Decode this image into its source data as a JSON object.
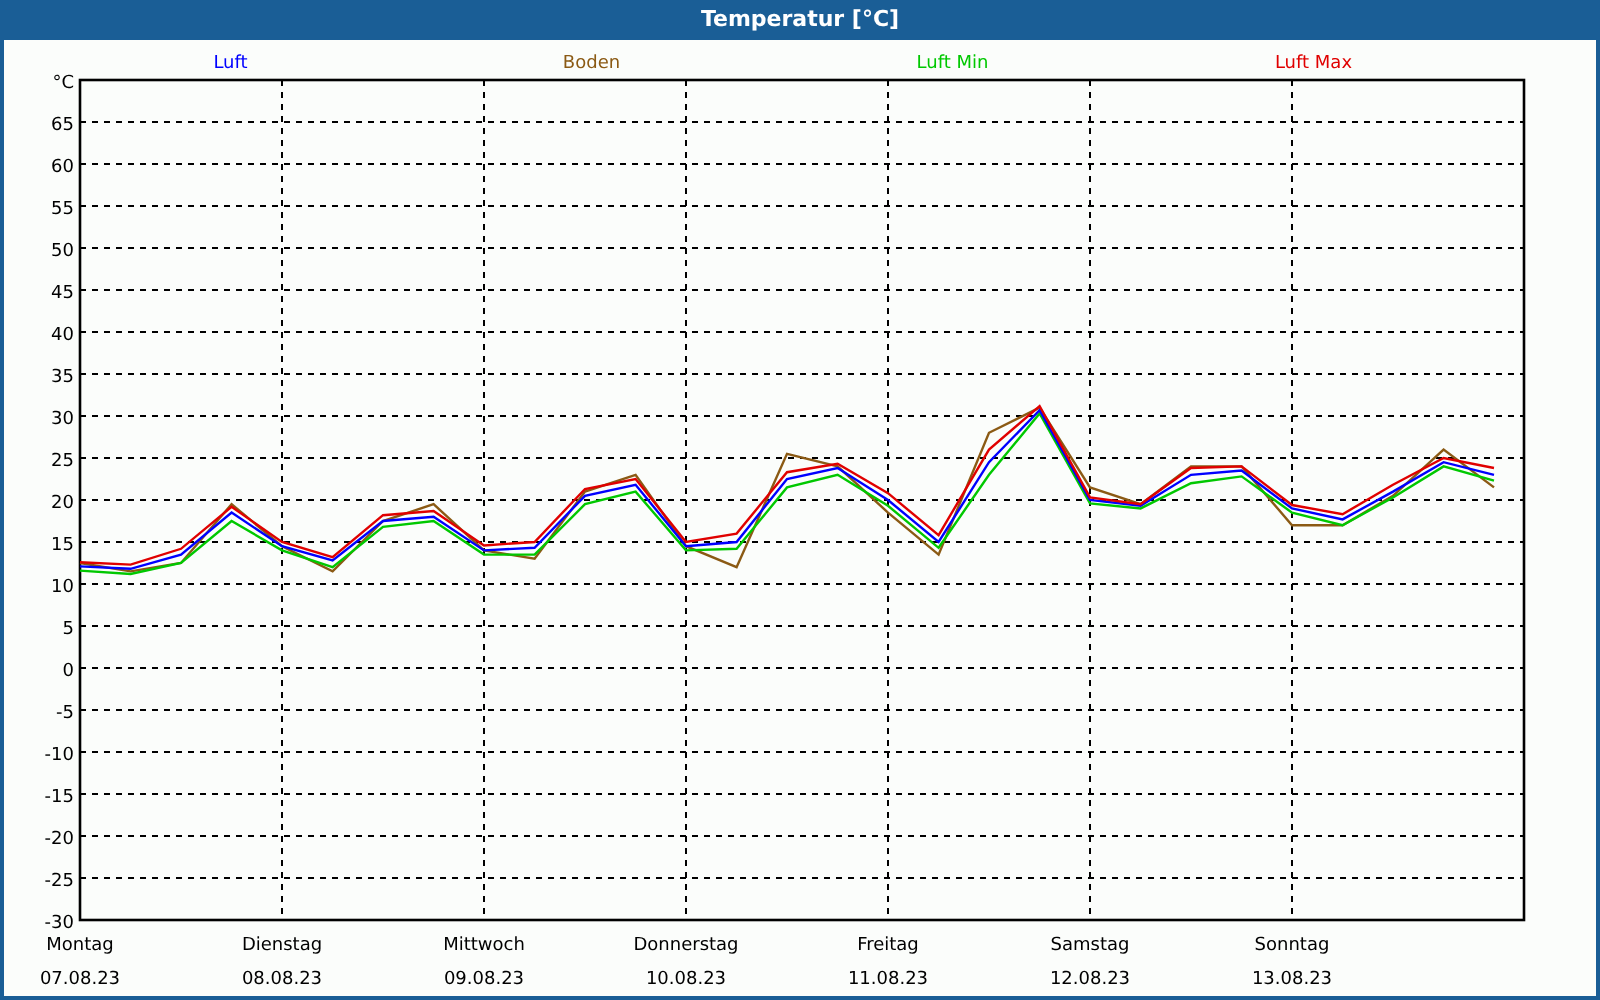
{
  "chart_data": {
    "type": "line",
    "title": "Temperatur [°C]",
    "categories": [
      "Montag 07.08.23",
      null,
      null,
      null,
      "Dienstag 08.08.23",
      null,
      null,
      null,
      "Mittwoch 09.08.23",
      null,
      null,
      null,
      "Donnerstag 10.08.23",
      null,
      null,
      null,
      "Freitag 11.08.23",
      null,
      null,
      null,
      "Samstag 12.08.23",
      null,
      null,
      null,
      "Sonntag 13.08.23",
      null,
      null,
      null,
      null
    ],
    "series": [
      {
        "name": "Luft",
        "color": "#0000ff",
        "values": [
          12.1,
          11.8,
          13.5,
          18.5,
          14.5,
          12.8,
          17.5,
          18.0,
          14.0,
          14.3,
          20.5,
          21.8,
          14.5,
          15.0,
          22.5,
          23.8,
          20.0,
          15.0,
          24.5,
          30.7,
          20.0,
          19.3,
          23.0,
          23.5,
          19.0,
          17.7,
          21.0,
          24.5,
          23.0
        ]
      },
      {
        "name": "Boden",
        "color": "#8b5a14",
        "values": [
          12.5,
          11.5,
          12.5,
          19.5,
          14.5,
          11.5,
          17.5,
          19.5,
          14.0,
          13.0,
          21.0,
          23.0,
          14.5,
          12.0,
          25.5,
          24.0,
          18.5,
          13.5,
          28.0,
          31.0,
          21.5,
          19.5,
          24.0,
          24.0,
          17.0,
          17.0,
          20.5,
          26.0,
          21.5
        ]
      },
      {
        "name": "Luft Min",
        "color": "#00c800",
        "values": [
          11.6,
          11.2,
          12.5,
          17.5,
          14.0,
          12.0,
          16.8,
          17.5,
          13.5,
          13.5,
          19.5,
          21.0,
          14.0,
          14.2,
          21.5,
          23.0,
          19.3,
          14.3,
          23.0,
          30.3,
          19.6,
          19.0,
          22.0,
          22.8,
          18.5,
          17.0,
          20.3,
          24.0,
          22.3
        ]
      },
      {
        "name": "Luft Max",
        "color": "#e00000",
        "values": [
          12.6,
          12.3,
          14.2,
          19.2,
          15.0,
          13.2,
          18.2,
          18.7,
          14.6,
          15.0,
          21.3,
          22.5,
          15.0,
          16.0,
          23.3,
          24.3,
          20.8,
          15.8,
          26.0,
          31.2,
          20.3,
          19.5,
          23.8,
          24.0,
          19.4,
          18.3,
          21.8,
          25.0,
          23.8
        ]
      }
    ],
    "grid": true,
    "ylim": [
      -30,
      70
    ],
    "yticks": [
      -30,
      -25,
      -20,
      -15,
      -10,
      -5,
      0,
      5,
      10,
      15,
      20,
      25,
      30,
      35,
      40,
      45,
      50,
      55,
      60,
      65,
      {
        "value": 70,
        "label": "°C"
      }
    ]
  }
}
